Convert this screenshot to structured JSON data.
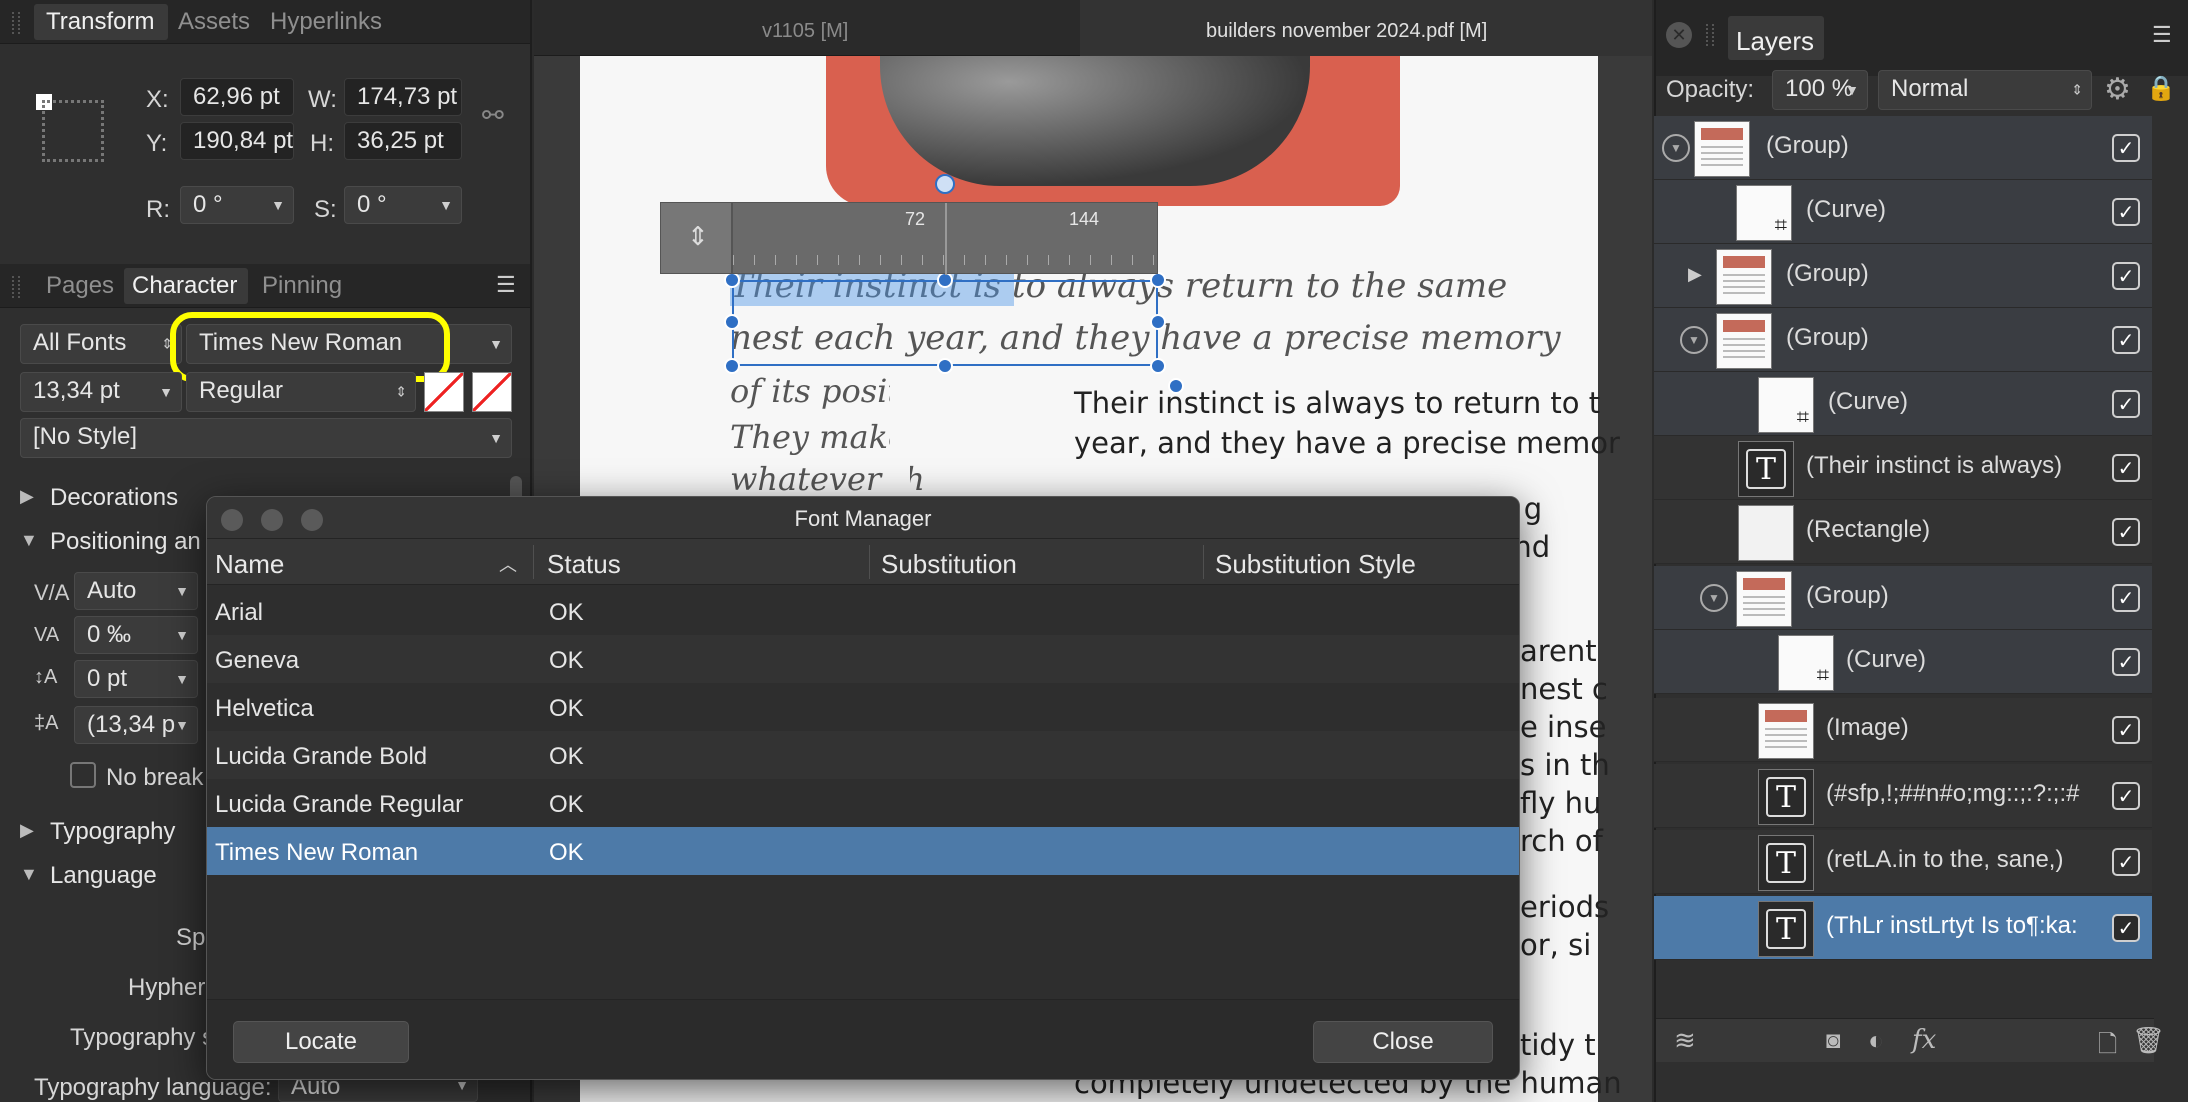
{
  "transform_panel": {
    "tabs": [
      "Transform",
      "Assets",
      "Hyperlinks"
    ],
    "x_label": "X:",
    "x_value": "62,96 pt",
    "y_label": "Y:",
    "y_value": "190,84 pt",
    "w_label": "W:",
    "w_value": "174,73 pt",
    "h_label": "H:",
    "h_value": "36,25 pt",
    "r_label": "R:",
    "r_value": "0 °",
    "s_label": "S:",
    "s_value": "0 °"
  },
  "character_panel": {
    "tabs": [
      "Pages",
      "Character",
      "Pinning"
    ],
    "font_collection": "All Fonts",
    "font_family": "Times New Roman",
    "font_size": "13,34 pt",
    "font_style": "Regular",
    "paragraph_style": "[No Style]",
    "sections": [
      "Decorations",
      "Positioning an",
      "Typography",
      "Language"
    ],
    "kerning_value": "Auto",
    "tracking_value": "0 ‰",
    "baseline_value": "0 pt",
    "leading_value": "(13,34 p",
    "no_break_label": "No break",
    "language_labels": [
      "Sp",
      "Hypher",
      "Typography s"
    ],
    "typography_language_label": "Typography language:",
    "typography_language_value": "Auto",
    "highlight_color": "#ffff00"
  },
  "document": {
    "tab_left": "v1105  [M]",
    "tab_right": "builders november 2024.pdf [M]",
    "ruler_ticks": [
      "72",
      "144"
    ],
    "handwriting_lines": [
      "Their instinct is to always return to the same",
      "nest each year, and they have a precise memory",
      "of its posit",
      "They make",
      "whatever th"
    ],
    "body_lines": [
      "Their instinct is always to return to t",
      "year, and they have a precise memor",
      "and g",
      "r –and",
      "arent",
      "nest c",
      "e inse",
      "s in th",
      "fly hu",
      "rch of",
      "eriods",
      "or, si",
      "tidy t",
      "completely undetected by the human"
    ]
  },
  "font_manager": {
    "title": "Font Manager",
    "columns": [
      "Name",
      "Status",
      "Substitution",
      "Substitution Style"
    ],
    "rows": [
      {
        "name": "Arial",
        "status": "OK"
      },
      {
        "name": "Geneva",
        "status": "OK"
      },
      {
        "name": "Helvetica",
        "status": "OK"
      },
      {
        "name": "Lucida Grande Bold",
        "status": "OK"
      },
      {
        "name": "Lucida Grande Regular",
        "status": "OK"
      },
      {
        "name": "Times New Roman",
        "status": "OK"
      }
    ],
    "selected_index": 5,
    "locate_label": "Locate",
    "close_label": "Close"
  },
  "layers_panel": {
    "title": "Layers",
    "opacity_label": "Opacity:",
    "opacity_value": "100 %",
    "blend_mode": "Normal",
    "layers": [
      {
        "name": "(Group)"
      },
      {
        "name": "(Curve)"
      },
      {
        "name": "(Group)"
      },
      {
        "name": "(Group)"
      },
      {
        "name": "(Curve)"
      },
      {
        "name": "(Their instinct is always)"
      },
      {
        "name": "(Rectangle)"
      },
      {
        "name": "(Group)"
      },
      {
        "name": "(Curve)"
      },
      {
        "name": "(Image)"
      },
      {
        "name": "(#sfp,!;##n#o;mg::;:?:;:#"
      },
      {
        "name": "(retLA.in to the, sane,)"
      },
      {
        "name": "(ThLr instLrtyt Is to¶:ka:"
      }
    ],
    "accent_color": "#4d7aa8"
  }
}
